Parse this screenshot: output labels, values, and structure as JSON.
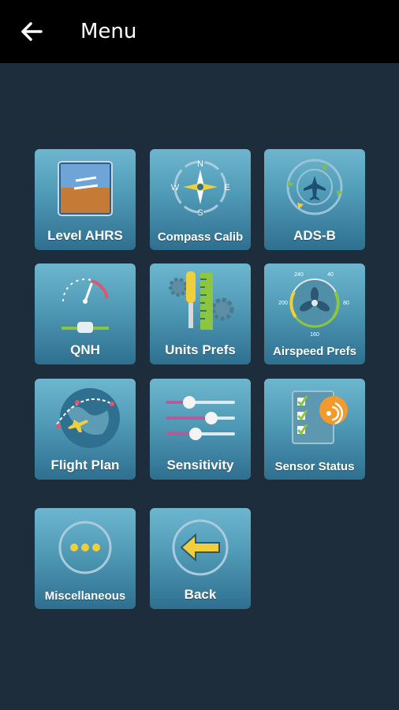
{
  "header": {
    "title": "Menu",
    "back_icon": "arrow-left-icon"
  },
  "menu": {
    "level_ahrs": "Level AHRS",
    "compass_calib": "Compass Calib",
    "ads_b": "ADS-B",
    "qnh": "QNH",
    "units_prefs": "Units Prefs",
    "airspeed_prefs": "Airspeed Prefs",
    "flight_plan": "Flight Plan",
    "sensitivity": "Sensitivity",
    "sensor_status": "Sensor Status",
    "miscellaneous": "Miscellaneous",
    "back": "Back"
  },
  "compass_letters": {
    "n": "N",
    "e": "E",
    "s": "S",
    "w": "W"
  },
  "airspeed_ticks": {
    "t1": "240",
    "t2": "40",
    "t3": "200",
    "t4": "80",
    "t5": "160"
  },
  "colors": {
    "background": "#1e2d3b",
    "topbar": "#000000",
    "tile_top": "#6eb6cf",
    "tile_bottom": "#2f6f8f",
    "accent_yellow": "#f1cf3c"
  }
}
